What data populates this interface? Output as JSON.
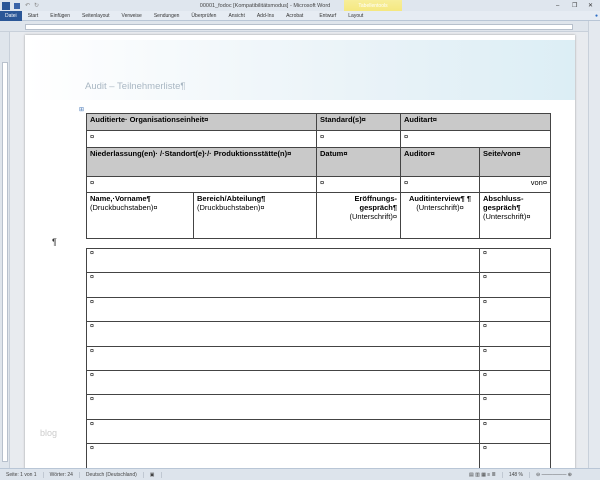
{
  "window": {
    "title": "00001_fodoc [Kompatibilitätsmodus] - Microsoft Word",
    "context_tab": "Tabellentools"
  },
  "ribbon": {
    "tabs": [
      "Datei",
      "Start",
      "Einfügen",
      "Seitenlayout",
      "Verweise",
      "Sendungen",
      "Überprüfen",
      "Ansicht",
      "Add-Ins",
      "Acrobat",
      "Entwurf",
      "Layout"
    ]
  },
  "document": {
    "title": "Audit – Teilnehmerliste¶",
    "watermark": "blog",
    "pilcrow": "¶",
    "table": {
      "row1": [
        "Auditierte· Organisationseinheit¤",
        "Standard(s)¤",
        "Auditart¤"
      ],
      "row2": [
        "¤",
        "¤",
        "¤"
      ],
      "row3": [
        "Niederlassung(en)· /·Standort(e)·/· Produktionsstätte(n)¤",
        "Datum¤",
        "Auditor¤",
        "Seite/von¤"
      ],
      "row4": [
        "¤",
        "¤",
        "¤",
        "von¤"
      ],
      "row5": [
        {
          "label": "Name,·Vorname¶",
          "sub": "(Druckbuchstaben)¤"
        },
        {
          "label": "Bereich/Abteilung¶",
          "sub": "(Druckbuchstaben)¤"
        },
        {
          "label": "Eröffnungs-gespräch¶",
          "sub": "(Unterschrift)¤"
        },
        {
          "label": "Auditinterview¶ ¶",
          "sub": "(Unterschrift)¤"
        },
        {
          "label": "Abschluss-gespräch¶",
          "sub": "(Unterschrift)¤"
        }
      ],
      "cell_mark": "¤"
    }
  },
  "status": {
    "page": "Seite: 1 von 1",
    "words": "Wörter: 24",
    "language": "Deutsch (Deutschland)",
    "zoom": "148 %"
  }
}
